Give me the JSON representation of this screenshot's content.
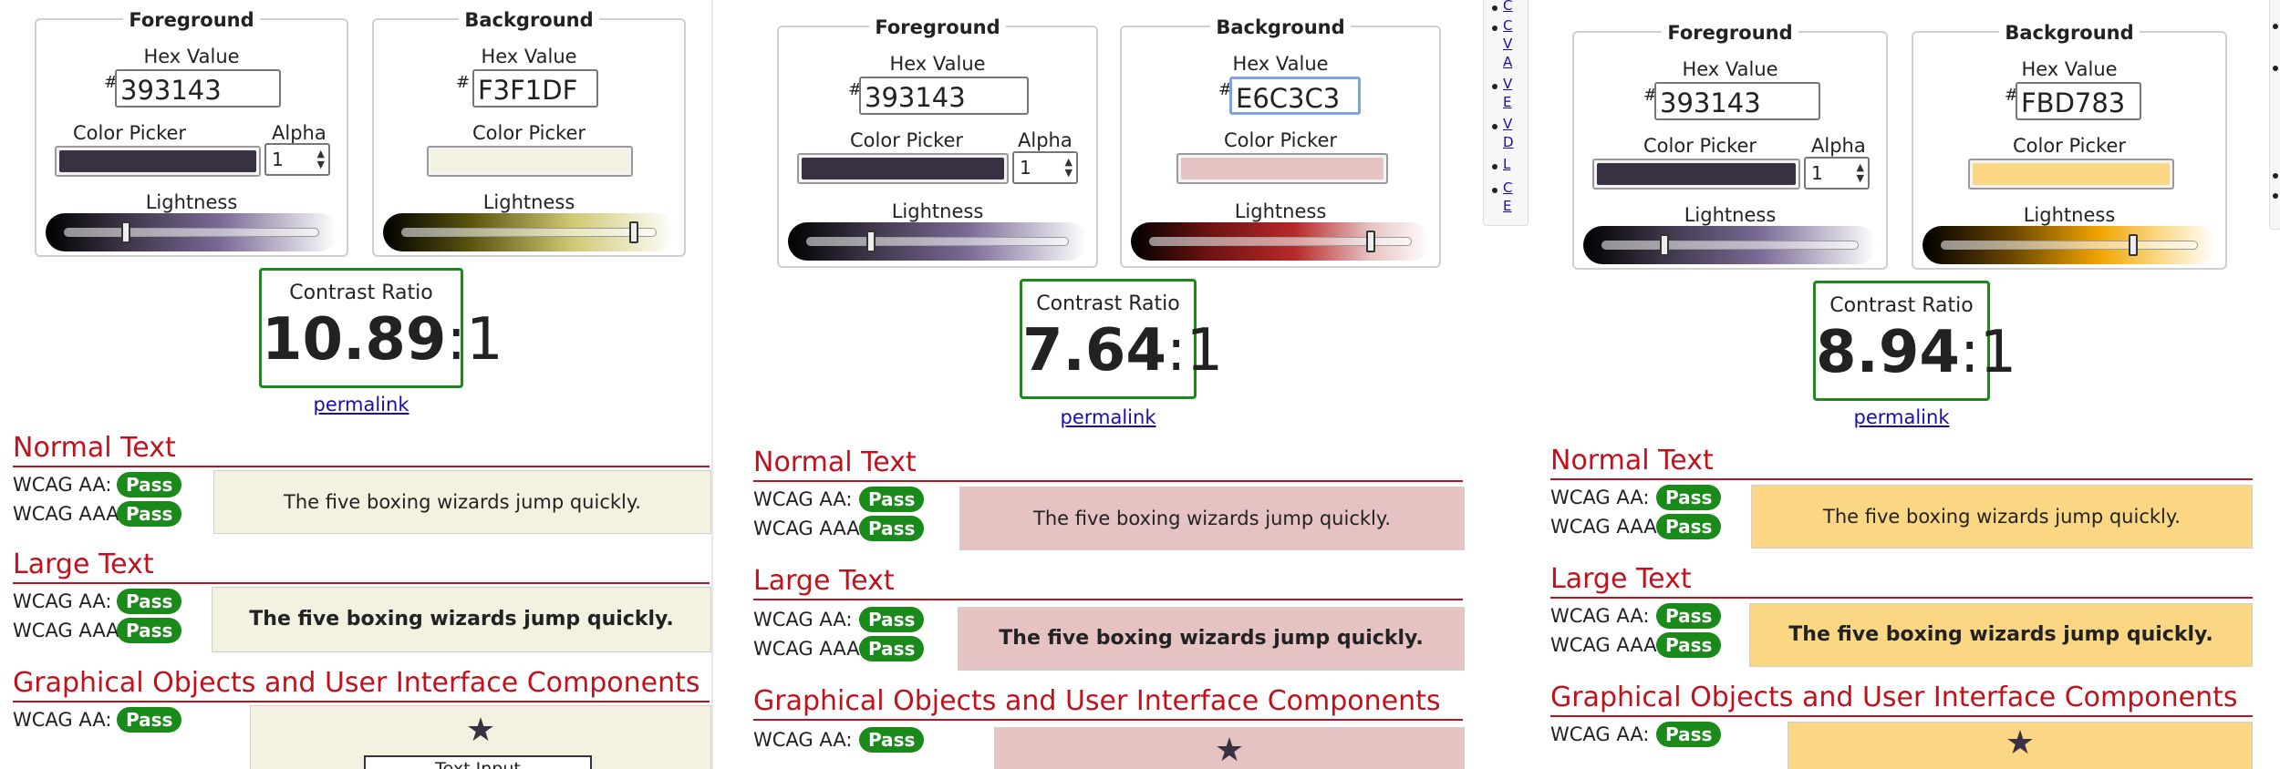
{
  "labels": {
    "foreground": "Foreground",
    "background": "Background",
    "hex_value": "Hex Value",
    "hash": "#",
    "color_picker": "Color Picker",
    "alpha": "Alpha",
    "lightness": "Lightness",
    "contrast_ratio": "Contrast Ratio",
    "permalink": "permalink",
    "normal_text": "Normal Text",
    "large_text": "Large Text",
    "graphical_objects": "Graphical Objects and User Interface Components",
    "wcag_aa": "WCAG AA:",
    "wcag_aaa": "WCAG AAA:",
    "pass": "Pass",
    "sample_text": "The five boxing wizards jump quickly.",
    "star": "★",
    "text_input": "Text Input"
  },
  "panels": [
    {
      "foreground": {
        "hex": "393143",
        "color": "#393143",
        "alpha": "1",
        "lightness": 0.24
      },
      "background": {
        "hex": "F3F1DF",
        "color": "#F3F1DF",
        "lightness": 0.93
      },
      "ratio_bold": "10.89",
      "ratio_rest": ":1",
      "slider_colors": {
        "fg_mid": "#7a6a95",
        "bg_mid": "#8f8626"
      }
    },
    {
      "foreground": {
        "hex": "393143",
        "color": "#393143",
        "alpha": "1",
        "lightness": 0.24
      },
      "background": {
        "hex": "E6C3C3",
        "color": "#E6C3C3",
        "lightness": 0.83
      },
      "ratio_bold": "7.64",
      "ratio_rest": ":1",
      "slider_colors": {
        "fg_mid": "#7a6a95",
        "bg_mid": "#b82a2a"
      }
    },
    {
      "foreground": {
        "hex": "393143",
        "color": "#393143",
        "alpha": "1",
        "lightness": 0.24
      },
      "background": {
        "hex": "FBD783",
        "color": "#FBD783",
        "lightness": 0.75
      },
      "ratio_bold": "8.94",
      "ratio_rest": ":1",
      "slider_colors": {
        "fg_mid": "#7a6a95",
        "bg_mid": "#f0a400"
      }
    }
  ],
  "side_nav": [
    "C",
    "C",
    "V",
    "A",
    "V",
    "E",
    "V",
    "D",
    "L",
    "C",
    "E"
  ],
  "colors": {
    "pass_green": "#1a8a1a",
    "heading_red": "#c0121c",
    "link_blue": "#1a0dab"
  }
}
